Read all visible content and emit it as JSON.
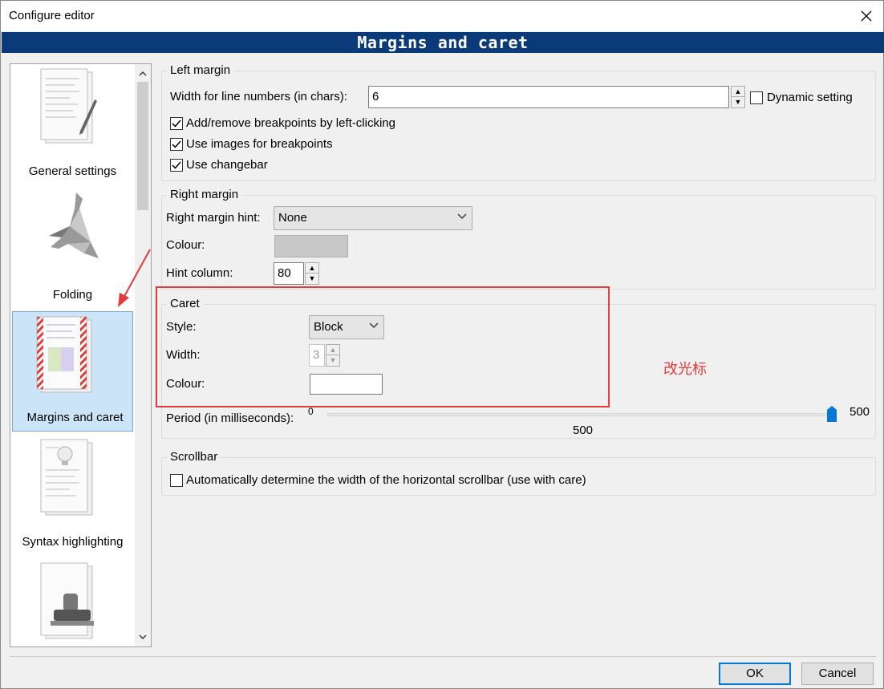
{
  "window": {
    "title": "Configure editor"
  },
  "banner": {
    "title": "Margins and caret"
  },
  "sidebar": {
    "items": [
      {
        "label": "General settings"
      },
      {
        "label": "Folding"
      },
      {
        "label": "Margins and caret",
        "selected": true
      },
      {
        "label": "Syntax highlighting"
      },
      {
        "label": ""
      }
    ]
  },
  "left_margin": {
    "title": "Left margin",
    "width_label": "Width for line numbers (in chars):",
    "width_value": "6",
    "dynamic_label": "Dynamic setting",
    "dynamic_checked": false,
    "breakpoints_label": "Add/remove breakpoints by left-clicking",
    "images_label": "Use images for breakpoints",
    "changebar_label": "Use changebar"
  },
  "right_margin": {
    "title": "Right margin",
    "hint_label": "Right margin hint:",
    "hint_value": "None",
    "colour_label": "Colour:",
    "colour_value": "#c8c8c8",
    "column_label": "Hint column:",
    "column_value": "80"
  },
  "caret": {
    "title": "Caret",
    "style_label": "Style:",
    "style_value": "Block",
    "width_label": "Width:",
    "width_value": "3",
    "colour_label": "Colour:",
    "colour_value": "#ffffff",
    "period_label": "Period (in milliseconds):",
    "period_min": "0",
    "period_max": "500",
    "period_value": "500"
  },
  "scrollbar": {
    "title": "Scrollbar",
    "auto_label": "Automatically determine the width of the horizontal scrollbar (use with care)"
  },
  "annotation": {
    "text": "改光标",
    "color": "#e23b3b"
  },
  "buttons": {
    "ok": "OK",
    "cancel": "Cancel"
  }
}
